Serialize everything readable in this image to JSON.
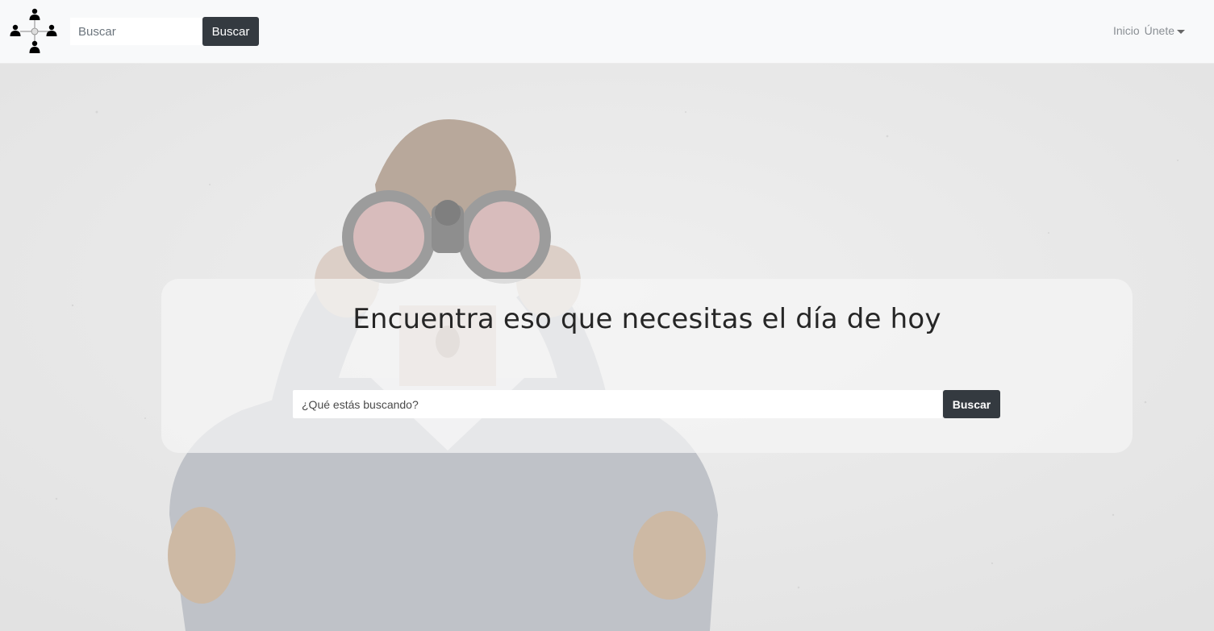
{
  "navbar": {
    "logo_icon": "people-network-icon",
    "search": {
      "placeholder": "Buscar",
      "value": ""
    },
    "search_button_label": "Buscar",
    "links": [
      {
        "label": "Inicio"
      },
      {
        "label": "Únete",
        "dropdown": true,
        "icon": "caret-down-icon"
      }
    ]
  },
  "hero": {
    "background": "photo-man-with-binoculars",
    "title": "Encuentra eso que necesitas el día de hoy",
    "search": {
      "placeholder": "¿Qué estás buscando?",
      "value": ""
    },
    "search_button_label": "Buscar"
  },
  "colors": {
    "navbar_bg": "#f8f9fa",
    "button_dark": "#343a40",
    "card_bg": "rgba(245,245,245,0.72)",
    "link_text": "#8a8f94"
  }
}
